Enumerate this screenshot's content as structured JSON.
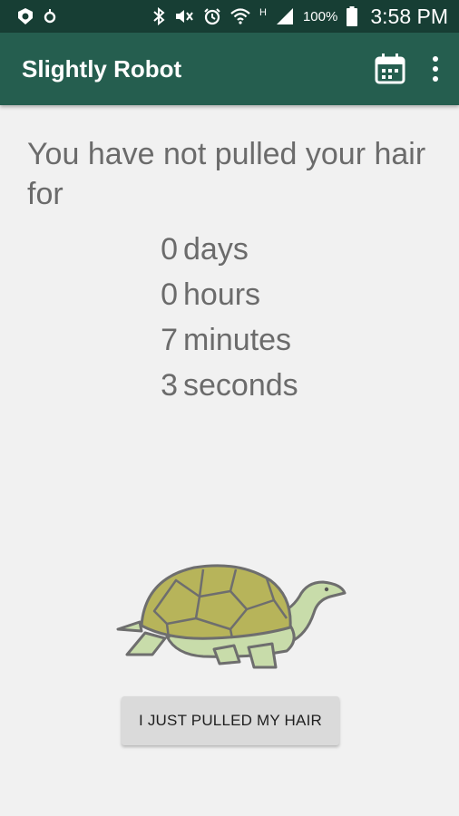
{
  "status_bar": {
    "battery_percent": "100%",
    "time": "3:58 PM",
    "network_type": "H",
    "icons": [
      "notification-icon",
      "location-icon",
      "bluetooth-icon",
      "mute-icon",
      "alarm-icon",
      "wifi-icon",
      "signal-icon",
      "battery-icon"
    ]
  },
  "app_bar": {
    "title": "Slightly Robot",
    "actions": [
      "calendar-icon",
      "overflow-menu-icon"
    ],
    "color": "#255e4f"
  },
  "main": {
    "message": "You have not pulled your hair for",
    "counter": [
      {
        "value": "0",
        "unit": "days"
      },
      {
        "value": "0",
        "unit": "hours"
      },
      {
        "value": "7",
        "unit": "minutes"
      },
      {
        "value": "3",
        "unit": "seconds"
      }
    ],
    "button_label": "I JUST PULLED MY HAIR"
  }
}
